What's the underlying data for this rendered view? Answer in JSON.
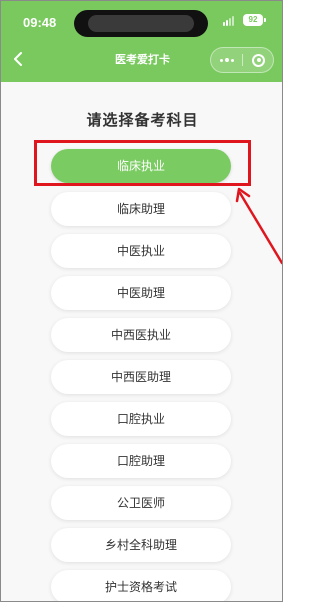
{
  "status_bar": {
    "time": "09:48",
    "battery": "92"
  },
  "nav": {
    "title": "医考爱打卡"
  },
  "page": {
    "heading": "请选择备考科目"
  },
  "subjects": [
    {
      "label": "临床执业",
      "selected": true
    },
    {
      "label": "临床助理",
      "selected": false
    },
    {
      "label": "中医执业",
      "selected": false
    },
    {
      "label": "中医助理",
      "selected": false
    },
    {
      "label": "中西医执业",
      "selected": false
    },
    {
      "label": "中西医助理",
      "selected": false
    },
    {
      "label": "口腔执业",
      "selected": false
    },
    {
      "label": "口腔助理",
      "selected": false
    },
    {
      "label": "公卫医师",
      "selected": false
    },
    {
      "label": "乡村全科助理",
      "selected": false
    },
    {
      "label": "护士资格考试",
      "selected": false
    }
  ],
  "colors": {
    "brand_green": "#79c95e",
    "selected_green": "#7acc62",
    "annotation_red": "#e0161f"
  }
}
